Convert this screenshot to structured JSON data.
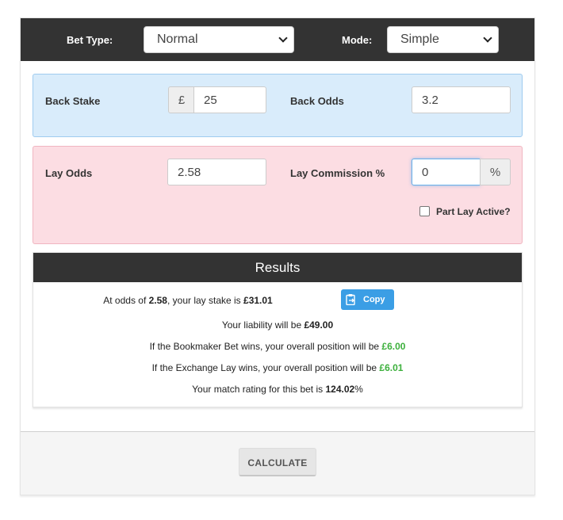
{
  "header": {
    "bet_type_label": "Bet Type:",
    "bet_type_value": "Normal",
    "mode_label": "Mode:",
    "mode_value": "Simple"
  },
  "back": {
    "stake_label": "Back Stake",
    "currency_symbol": "£",
    "stake_value": "25",
    "odds_label": "Back Odds",
    "odds_value": "3.2"
  },
  "lay": {
    "odds_label": "Lay Odds",
    "odds_value": "2.58",
    "commission_label": "Lay Commission %",
    "commission_value": "0",
    "percent_symbol": "%",
    "part_lay_label": "Part Lay Active?",
    "part_lay_checked": false
  },
  "results": {
    "title": "Results",
    "line1_prefix": "At odds of ",
    "line1_odds": "2.58",
    "line1_mid": ", your lay stake is ",
    "line1_stake": "£31.01",
    "copy_label": "Copy",
    "line2_prefix": "Your liability will be ",
    "line2_value": "£49.00",
    "line3_prefix": "If the Bookmaker Bet wins, your overall position will be ",
    "line3_value": "£6.00",
    "line4_prefix": "If the Exchange Lay wins, your overall position will be ",
    "line4_value": "£6.01",
    "line5_prefix": "Your match rating for this bet is ",
    "line5_value": "124.02",
    "line5_suffix": "%"
  },
  "footer": {
    "calculate_label": "CALCULATE"
  },
  "colors": {
    "header_bg": "#333333",
    "back_panel": "#d9ecfb",
    "lay_panel": "#fcdde3",
    "positive": "#3cb03c",
    "copy_button": "#3b9ee5"
  }
}
